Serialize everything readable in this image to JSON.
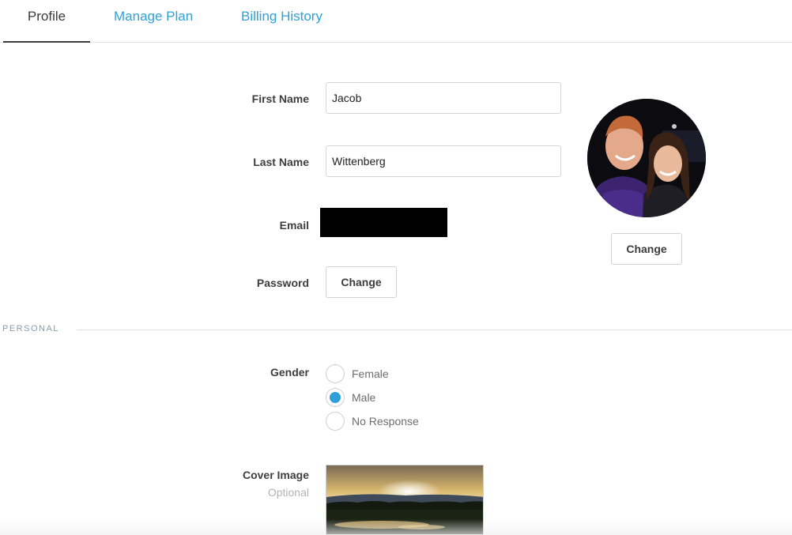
{
  "tabs": [
    {
      "label": "Profile",
      "active": true
    },
    {
      "label": "Manage Plan",
      "active": false
    },
    {
      "label": "Billing History",
      "active": false
    }
  ],
  "form": {
    "first_name_label": "First Name",
    "first_name_value": "Jacob",
    "last_name_label": "Last Name",
    "last_name_value": "Wittenberg",
    "email_label": "Email",
    "password_label": "Password",
    "password_button": "Change"
  },
  "avatar": {
    "change_button": "Change"
  },
  "personal": {
    "section_title": "PERSONAL",
    "gender_label": "Gender",
    "gender_options": [
      {
        "label": "Female",
        "checked": false
      },
      {
        "label": "Male",
        "checked": true
      },
      {
        "label": "No Response",
        "checked": false
      }
    ],
    "cover_label": "Cover Image",
    "cover_sublabel": "Optional"
  },
  "colors": {
    "accent": "#2ea1d7",
    "radio_selected": "#2f9fd9",
    "section_title": "#8a9ba6"
  }
}
